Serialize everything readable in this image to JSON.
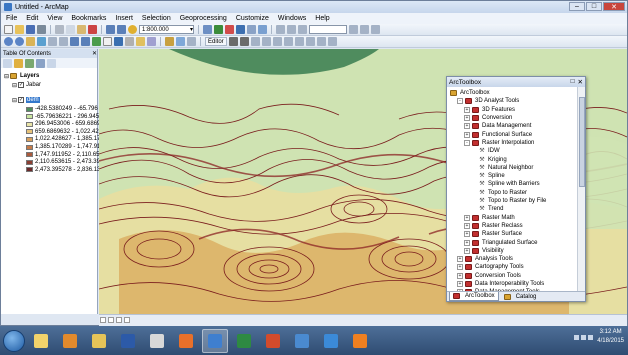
{
  "window": {
    "title": "Untitled - ArcMap"
  },
  "menubar": {
    "items": [
      "File",
      "Edit",
      "View",
      "Bookmarks",
      "Insert",
      "Selection",
      "Geoprocessing",
      "Customize",
      "Windows",
      "Help"
    ]
  },
  "toolbar": {
    "scale": "1:800.000",
    "editor_label": "Editor"
  },
  "toc": {
    "title": "Table Of Contents",
    "root_label": "Layers",
    "layers": [
      {
        "name": "Jabar",
        "checked": true
      },
      {
        "name": "dem",
        "checked": true
      }
    ],
    "legend": [
      {
        "label": "-428.5380249 - -65.796",
        "color": "#4e8e5e"
      },
      {
        "label": "-65.79636221 - 296.945",
        "color": "#c8e6a0"
      },
      {
        "label": "296.9453006 - 659.6869",
        "color": "#e9e4a8"
      },
      {
        "label": "659.6869632 - 1,022.428",
        "color": "#e6c27a"
      },
      {
        "label": "1,022.428627 - 1,385.17",
        "color": "#d8a05e"
      },
      {
        "label": "1,385.170289 - 1,747.91",
        "color": "#c47a48"
      },
      {
        "label": "1,747.911952 - 2,110.65",
        "color": "#aa5a3c"
      },
      {
        "label": "2,110.653615 - 2,473.39",
        "color": "#8a3f33"
      },
      {
        "label": "2,473.395278 - 2,836.13",
        "color": "#6b2a2a"
      }
    ]
  },
  "arctoolbox": {
    "title": "ArcToolbox",
    "tabs": [
      {
        "label": "ArcToolbox"
      },
      {
        "label": "Catalog"
      }
    ],
    "items": [
      {
        "label": "ArcToolbox",
        "level": 0,
        "kind": "root",
        "toggle": ""
      },
      {
        "label": "3D Analyst Tools",
        "level": 1,
        "kind": "box",
        "toggle": "-"
      },
      {
        "label": "3D Features",
        "level": 2,
        "kind": "box",
        "toggle": "+"
      },
      {
        "label": "Conversion",
        "level": 2,
        "kind": "box",
        "toggle": "+"
      },
      {
        "label": "Data Management",
        "level": 2,
        "kind": "box",
        "toggle": "+"
      },
      {
        "label": "Functional Surface",
        "level": 2,
        "kind": "box",
        "toggle": "+"
      },
      {
        "label": "Raster Interpolation",
        "level": 2,
        "kind": "box",
        "toggle": "-"
      },
      {
        "label": "IDW",
        "level": 3,
        "kind": "tool",
        "toggle": ""
      },
      {
        "label": "Kriging",
        "level": 3,
        "kind": "tool",
        "toggle": ""
      },
      {
        "label": "Natural Neighbor",
        "level": 3,
        "kind": "tool",
        "toggle": ""
      },
      {
        "label": "Spline",
        "level": 3,
        "kind": "tool",
        "toggle": ""
      },
      {
        "label": "Spline with Barriers",
        "level": 3,
        "kind": "tool",
        "toggle": ""
      },
      {
        "label": "Topo to Raster",
        "level": 3,
        "kind": "tool",
        "toggle": ""
      },
      {
        "label": "Topo to Raster by File",
        "level": 3,
        "kind": "tool",
        "toggle": ""
      },
      {
        "label": "Trend",
        "level": 3,
        "kind": "tool",
        "toggle": ""
      },
      {
        "label": "Raster Math",
        "level": 2,
        "kind": "box",
        "toggle": "+"
      },
      {
        "label": "Raster Reclass",
        "level": 2,
        "kind": "box",
        "toggle": "+"
      },
      {
        "label": "Raster Surface",
        "level": 2,
        "kind": "box",
        "toggle": "+"
      },
      {
        "label": "Triangulated Surface",
        "level": 2,
        "kind": "box",
        "toggle": "+"
      },
      {
        "label": "Visibility",
        "level": 2,
        "kind": "box",
        "toggle": "+"
      },
      {
        "label": "Analysis Tools",
        "level": 1,
        "kind": "box",
        "toggle": "+"
      },
      {
        "label": "Cartography Tools",
        "level": 1,
        "kind": "box",
        "toggle": "+"
      },
      {
        "label": "Conversion Tools",
        "level": 1,
        "kind": "box",
        "toggle": "+"
      },
      {
        "label": "Data Interoperability Tools",
        "level": 1,
        "kind": "box",
        "toggle": "+"
      },
      {
        "label": "Data Management Tools",
        "level": 1,
        "kind": "box",
        "toggle": "+"
      }
    ]
  },
  "taskbar": {
    "apps": [
      "explorer-icon",
      "media-player-icon",
      "folder-icon",
      "word-icon",
      "notepad-icon",
      "firefox-icon",
      "arcmap-icon",
      "excel-icon",
      "powerpoint-icon",
      "network-icon",
      "quicktime-icon",
      "vlc-icon"
    ],
    "time": "3:12 AM",
    "date": "4/18/2015"
  }
}
